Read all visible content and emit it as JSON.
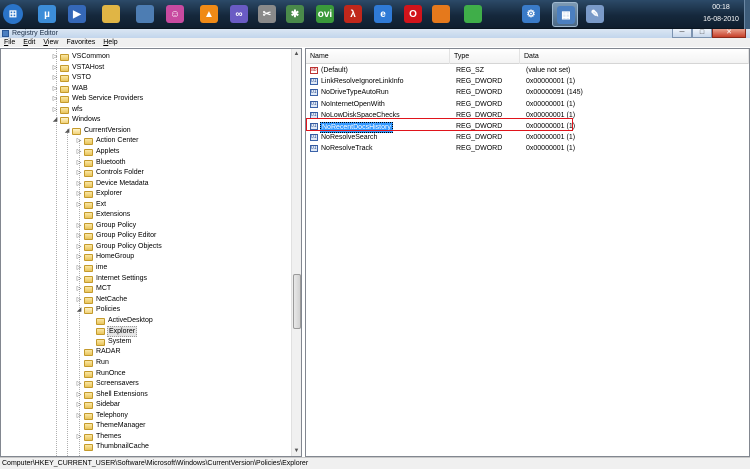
{
  "taskbar": {
    "icons": [
      {
        "name": "start-orb-icon",
        "color": "#2a74c9",
        "glyph": "⊞",
        "active": false
      },
      {
        "name": "utorrent-icon",
        "color": "#3c8dd8",
        "glyph": "µ",
        "active": false
      },
      {
        "name": "media-player-icon",
        "color": "#3568b8",
        "glyph": "▶",
        "active": false
      },
      {
        "name": "folder-icon",
        "color": "#e0b545",
        "glyph": "",
        "active": false
      },
      {
        "name": "monitor-icon",
        "color": "#4d7db3",
        "glyph": "",
        "active": false
      },
      {
        "name": "messenger-icon",
        "color": "#c84aa0",
        "glyph": "☺",
        "active": false
      },
      {
        "name": "vlc-icon",
        "color": "#f08a16",
        "glyph": "▲",
        "active": false
      },
      {
        "name": "infinity-icon",
        "color": "#6a5bc4",
        "glyph": "∞",
        "active": false
      },
      {
        "name": "tools-icon",
        "color": "#8a8a8a",
        "glyph": "✂",
        "active": false
      },
      {
        "name": "gear-puzzle-icon",
        "color": "#4a8a4a",
        "glyph": "✱",
        "active": false
      },
      {
        "name": "ovi-icon",
        "color": "#3a9a3a",
        "glyph": "ovi",
        "active": false
      },
      {
        "name": "pdf-icon",
        "color": "#c0271b",
        "glyph": "λ",
        "active": false
      },
      {
        "name": "internet-explorer-icon",
        "color": "#2f7ad6",
        "glyph": "e",
        "active": false
      },
      {
        "name": "opera-icon",
        "color": "#d1141b",
        "glyph": "O",
        "active": false
      },
      {
        "name": "firefox-icon",
        "color": "#e5791c",
        "glyph": "",
        "active": false
      },
      {
        "name": "chrome-icon",
        "color": "#3fae49",
        "glyph": "",
        "active": false
      },
      {
        "name": "system-gear-icon",
        "color": "#3a7bc8",
        "glyph": "⚙",
        "active": false
      },
      {
        "name": "registry-editor-icon",
        "color": "#4b7fc0",
        "glyph": "▦",
        "active": true
      },
      {
        "name": "paint-icon",
        "color": "#7a9ac8",
        "glyph": "✎",
        "active": false
      }
    ],
    "clock_time": "00:18",
    "clock_date": "16-08-2010"
  },
  "window": {
    "title": "Registry Editor",
    "minimize": "─",
    "maximize": "□",
    "close": "✕"
  },
  "menu": [
    {
      "label": "File",
      "accel": "F",
      "rest": "ile"
    },
    {
      "label": "Edit",
      "accel": "E",
      "rest": "dit"
    },
    {
      "label": "View",
      "accel": "V",
      "rest": "iew"
    },
    {
      "label": "Favorites",
      "accel": "",
      "rest": "Favorites"
    },
    {
      "label": "Help",
      "accel": "H",
      "rest": "elp"
    }
  ],
  "tree": [
    {
      "label": "VSCommon",
      "level": 0,
      "expanded": false
    },
    {
      "label": "VSTAHost",
      "level": 0,
      "expanded": false
    },
    {
      "label": "VSTO",
      "level": 0,
      "expanded": false
    },
    {
      "label": "WAB",
      "level": 0,
      "expanded": false
    },
    {
      "label": "Web Service Providers",
      "level": 0,
      "expanded": false
    },
    {
      "label": "wfs",
      "level": 0,
      "expanded": false
    },
    {
      "label": "Windows",
      "level": 0,
      "expanded": true
    },
    {
      "label": "CurrentVersion",
      "level": 1,
      "expanded": true
    },
    {
      "label": "Action Center",
      "level": 2,
      "expanded": false
    },
    {
      "label": "Applets",
      "level": 2,
      "expanded": false
    },
    {
      "label": "Bluetooth",
      "level": 2,
      "expanded": false
    },
    {
      "label": "Controls Folder",
      "level": 2,
      "expanded": false
    },
    {
      "label": "Device Metadata",
      "level": 2,
      "expanded": false
    },
    {
      "label": "Explorer",
      "level": 2,
      "expanded": false
    },
    {
      "label": "Ext",
      "level": 2,
      "expanded": false
    },
    {
      "label": "Extensions",
      "level": 2,
      "expanded": null
    },
    {
      "label": "Group Policy",
      "level": 2,
      "expanded": false
    },
    {
      "label": "Group Policy Editor",
      "level": 2,
      "expanded": false
    },
    {
      "label": "Group Policy Objects",
      "level": 2,
      "expanded": false
    },
    {
      "label": "HomeGroup",
      "level": 2,
      "expanded": false
    },
    {
      "label": "ime",
      "level": 2,
      "expanded": false
    },
    {
      "label": "Internet Settings",
      "level": 2,
      "expanded": false
    },
    {
      "label": "MCT",
      "level": 2,
      "expanded": false
    },
    {
      "label": "NetCache",
      "level": 2,
      "expanded": false
    },
    {
      "label": "Policies",
      "level": 2,
      "expanded": true
    },
    {
      "label": "ActiveDesktop",
      "level": 3,
      "expanded": null
    },
    {
      "label": "Explorer",
      "level": 3,
      "expanded": null,
      "selected": true
    },
    {
      "label": "System",
      "level": 3,
      "expanded": null
    },
    {
      "label": "RADAR",
      "level": 2,
      "expanded": null
    },
    {
      "label": "Run",
      "level": 2,
      "expanded": null
    },
    {
      "label": "RunOnce",
      "level": 2,
      "expanded": null
    },
    {
      "label": "Screensavers",
      "level": 2,
      "expanded": false
    },
    {
      "label": "Shell Extensions",
      "level": 2,
      "expanded": false
    },
    {
      "label": "Sidebar",
      "level": 2,
      "expanded": false
    },
    {
      "label": "Telephony",
      "level": 2,
      "expanded": false
    },
    {
      "label": "ThemeManager",
      "level": 2,
      "expanded": null
    },
    {
      "label": "Themes",
      "level": 2,
      "expanded": false
    },
    {
      "label": "ThumbnailCache",
      "level": 2,
      "expanded": null
    }
  ],
  "list": {
    "columns": [
      "Name",
      "Type",
      "Data"
    ],
    "rows": [
      {
        "name": "(Default)",
        "type": "REG_SZ",
        "data": "(value not set)",
        "kind": "sz"
      },
      {
        "name": "LinkResolveIgnoreLinkInfo",
        "type": "REG_DWORD",
        "data": "0x00000001 (1)",
        "kind": "dw"
      },
      {
        "name": "NoDriveTypeAutoRun",
        "type": "REG_DWORD",
        "data": "0x00000091 (145)",
        "kind": "dw"
      },
      {
        "name": "NoInternetOpenWith",
        "type": "REG_DWORD",
        "data": "0x00000001 (1)",
        "kind": "dw"
      },
      {
        "name": "NoLowDiskSpaceChecks",
        "type": "REG_DWORD",
        "data": "0x00000001 (1)",
        "kind": "dw"
      },
      {
        "name": "NoRecentDocsHistory",
        "type": "REG_DWORD",
        "data": "0x00000001 (1)",
        "kind": "dw",
        "selected": true
      },
      {
        "name": "NoResolveSearch",
        "type": "REG_DWORD",
        "data": "0x00000001 (1)",
        "kind": "dw"
      },
      {
        "name": "NoResolveTrack",
        "type": "REG_DWORD",
        "data": "0x00000001 (1)",
        "kind": "dw"
      }
    ]
  },
  "status": {
    "path": "Computer\\HKEY_CURRENT_USER\\Software\\Microsoft\\Windows\\CurrentVersion\\Policies\\Explorer"
  }
}
